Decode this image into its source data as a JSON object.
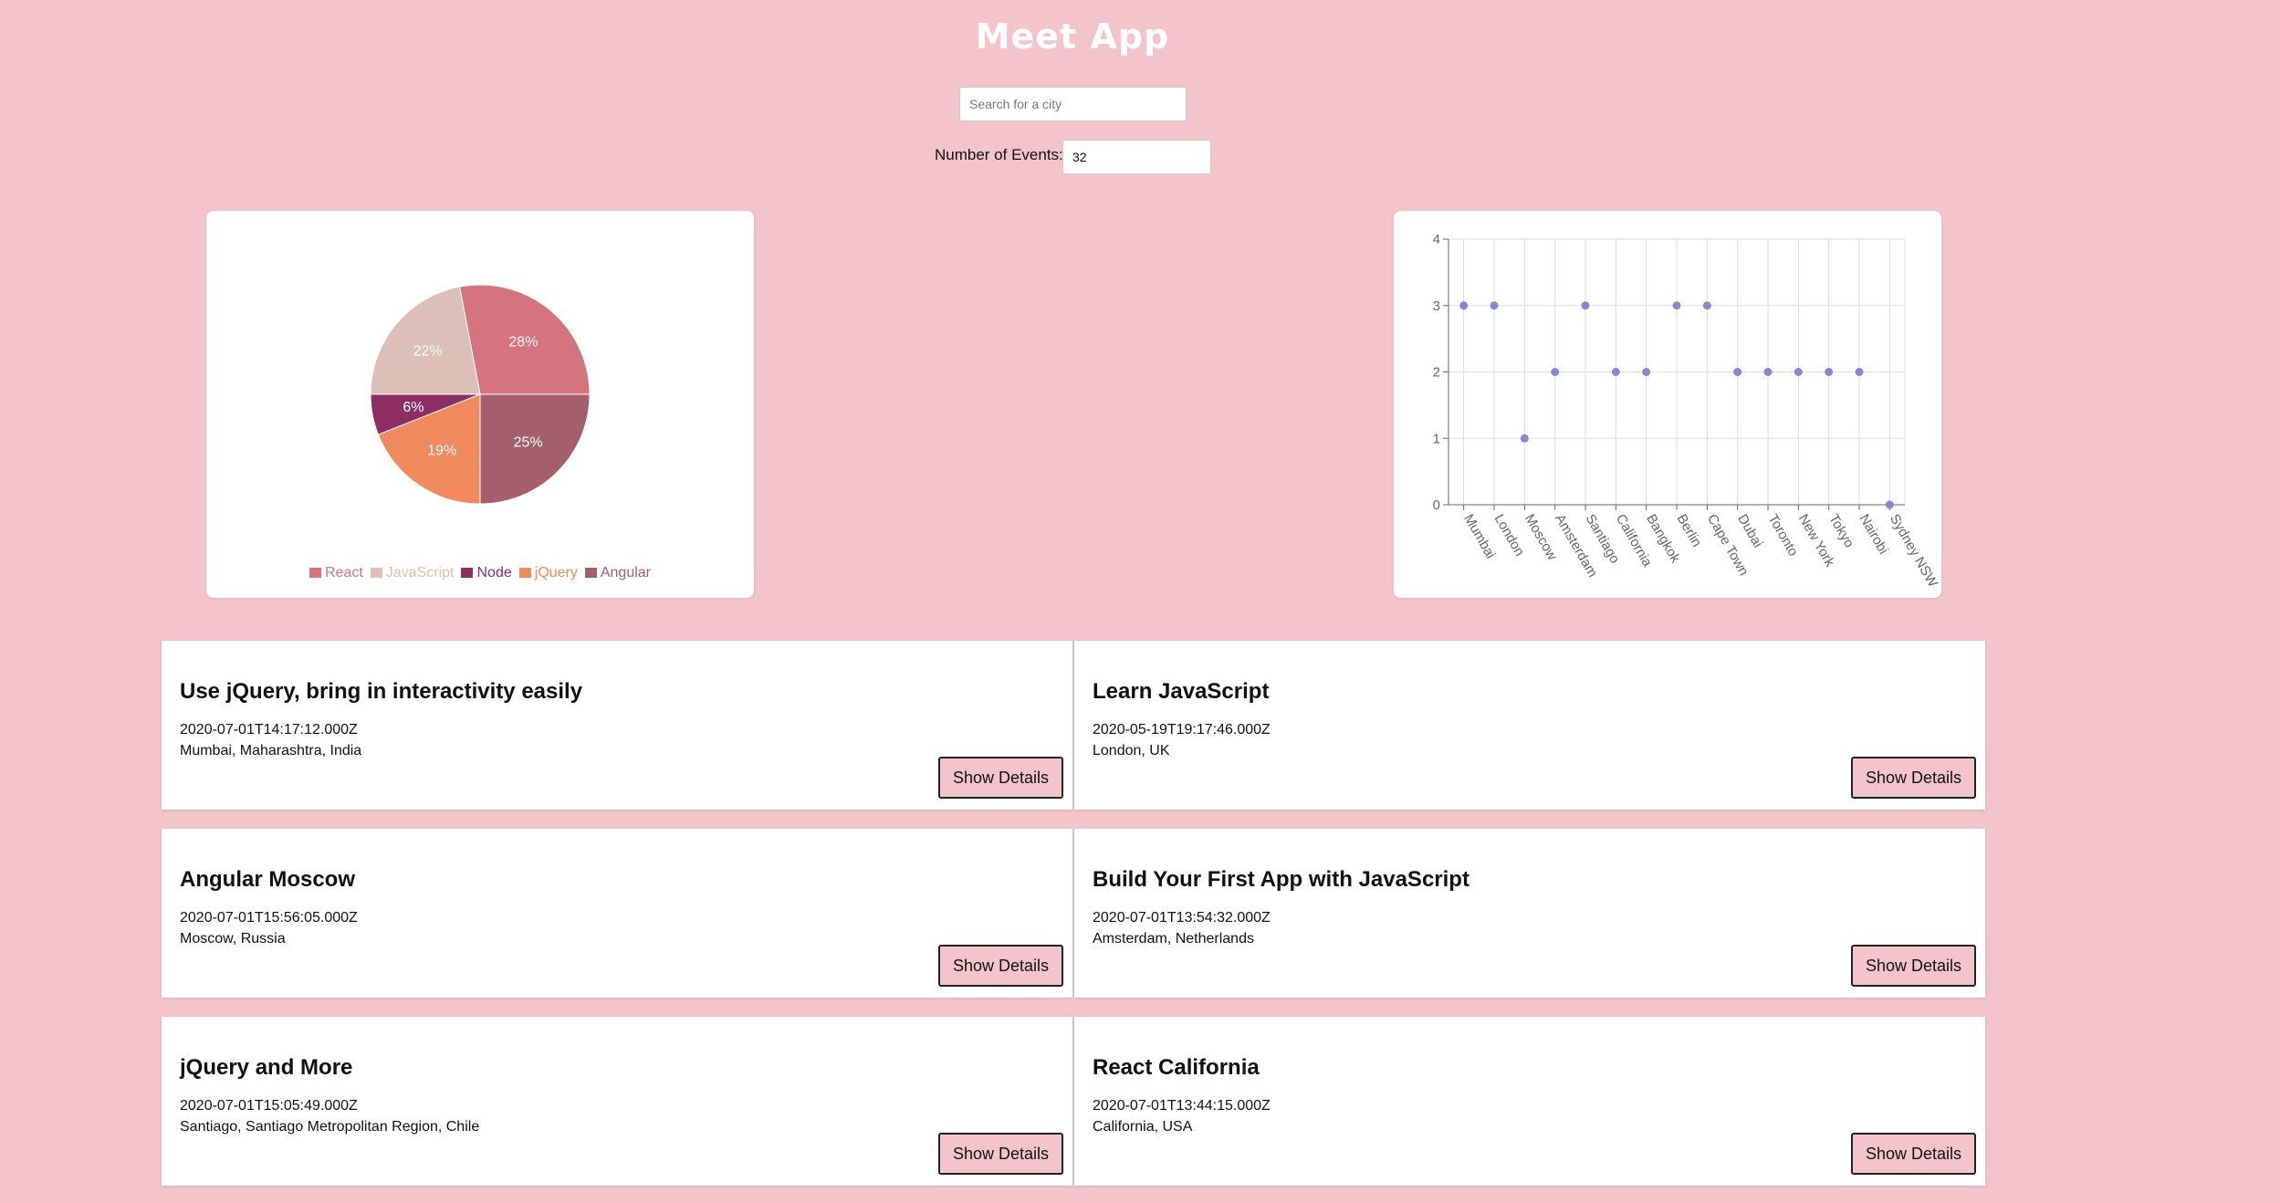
{
  "app": {
    "title": "Meet App"
  },
  "search": {
    "placeholder": "Search for a city",
    "value": ""
  },
  "number_of_events": {
    "label": "Number of Events:",
    "value": "32"
  },
  "chart_data": [
    {
      "type": "pie",
      "labels": [
        "React",
        "JavaScript",
        "Node",
        "jQuery",
        "Angular"
      ],
      "values": [
        28,
        22,
        6,
        19,
        25
      ],
      "value_labels": [
        "28%",
        "22%",
        "6%",
        "19%",
        "25%"
      ],
      "colors": [
        "#d5737f",
        "#dcc0b8",
        "#8e2c64",
        "#f0895d",
        "#a3606c"
      ],
      "legend_position": "bottom"
    },
    {
      "type": "scatter",
      "categories": [
        "Mumbai",
        "London",
        "Moscow",
        "Amsterdam",
        "Santiago",
        "California",
        "Bangkok",
        "Berlin",
        "Cape Town",
        "Dubai",
        "Toronto",
        "New York",
        "Tokyo",
        "Nairobi",
        "Sydney NSW"
      ],
      "values": [
        3,
        3,
        1,
        2,
        3,
        2,
        2,
        3,
        3,
        2,
        2,
        2,
        2,
        2,
        0
      ],
      "ylim": [
        0,
        4
      ],
      "yticks": [
        0,
        1,
        2,
        3,
        4
      ],
      "point_color": "#8884d8",
      "grid": true
    }
  ],
  "events": [
    {
      "title": "Use jQuery, bring in interactivity easily",
      "time": "2020-07-01T14:17:12.000Z",
      "location": "Mumbai, Maharashtra, India",
      "button": "Show Details"
    },
    {
      "title": "Learn JavaScript",
      "time": "2020-05-19T19:17:46.000Z",
      "location": "London, UK",
      "button": "Show Details"
    },
    {
      "title": "Angular Moscow",
      "time": "2020-07-01T15:56:05.000Z",
      "location": "Moscow, Russia",
      "button": "Show Details"
    },
    {
      "title": "Build Your First App with JavaScript",
      "time": "2020-07-01T13:54:32.000Z",
      "location": "Amsterdam, Netherlands",
      "button": "Show Details"
    },
    {
      "title": "jQuery and More",
      "time": "2020-07-01T15:05:49.000Z",
      "location": "Santiago, Santiago Metropolitan Region, Chile",
      "button": "Show Details"
    },
    {
      "title": "React California",
      "time": "2020-07-01T13:44:15.000Z",
      "location": "California, USA",
      "button": "Show Details"
    }
  ]
}
